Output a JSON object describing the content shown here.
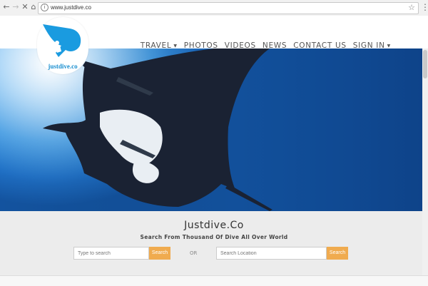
{
  "browser": {
    "url": "www.justdive.co"
  },
  "logo": {
    "text": "justdive.co"
  },
  "nav": {
    "items": [
      {
        "label": "TRAVEL",
        "dropdown": true
      },
      {
        "label": "PHOTOS",
        "dropdown": false
      },
      {
        "label": "VIDEOS",
        "dropdown": false
      },
      {
        "label": "NEWS",
        "dropdown": false
      },
      {
        "label": "CONTACT US",
        "dropdown": false
      },
      {
        "label": "SIGN IN",
        "dropdown": true
      }
    ]
  },
  "search": {
    "title": "Justdive.Co",
    "subtitle": "Search From Thousand Of Dive All Over World",
    "dive_placeholder": "Type to search",
    "dive_button": "Search",
    "or_label": "OR",
    "location_placeholder": "Search Location",
    "location_button": "Search"
  },
  "colors": {
    "accent": "#f0ab4f",
    "brand": "#1a8fd0"
  }
}
